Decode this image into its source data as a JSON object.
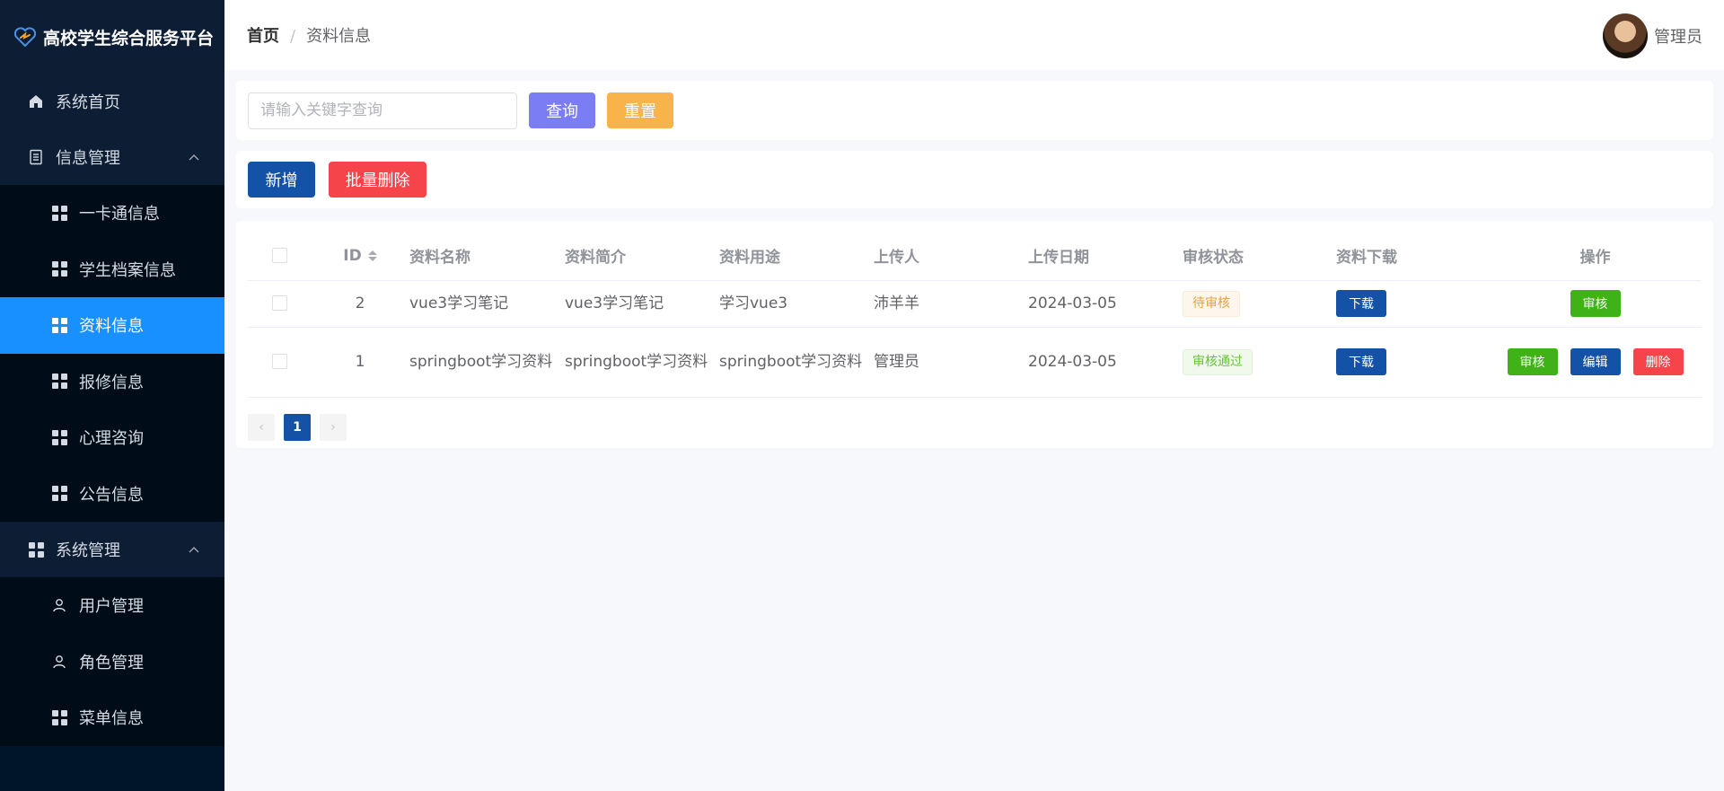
{
  "app": {
    "title": "高校学生综合服务平台"
  },
  "sidebar": {
    "home": "系统首页",
    "info_group": "信息管理",
    "info_items": [
      "一卡通信息",
      "学生档案信息",
      "资料信息",
      "报修信息",
      "心理咨询",
      "公告信息"
    ],
    "sys_group": "系统管理",
    "sys_items": [
      "用户管理",
      "角色管理",
      "菜单信息"
    ]
  },
  "header": {
    "breadcrumb_home": "首页",
    "breadcrumb_sep": "/",
    "breadcrumb_current": "资料信息",
    "user": "管理员"
  },
  "search": {
    "placeholder": "请输入关键字查询",
    "value": "",
    "query_label": "查询",
    "reset_label": "重置"
  },
  "actions": {
    "add_label": "新增",
    "batch_delete_label": "批量删除"
  },
  "table": {
    "columns": [
      "ID",
      "资料名称",
      "资料简介",
      "资料用途",
      "上传人",
      "上传日期",
      "审核状态",
      "资料下载",
      "操作"
    ],
    "rows": [
      {
        "id": "2",
        "name": "vue3学习笔记",
        "intro": "vue3学习笔记",
        "usage": "学习vue3",
        "uploader": "沛羊羊",
        "date": "2024-03-05",
        "status": "待审核",
        "download": "下载",
        "ops": [
          "审核"
        ]
      },
      {
        "id": "1",
        "name": "springboot学习资料",
        "intro": "springboot学习资料",
        "usage": "springboot学习资料",
        "uploader": "管理员",
        "date": "2024-03-05",
        "status": "审核通过",
        "download": "下载",
        "ops": [
          "审核",
          "编辑",
          "删除"
        ]
      }
    ]
  },
  "pagination": {
    "prev": "‹",
    "current": "1",
    "next": "›"
  },
  "colors": {
    "sidebar_bg": "#001529",
    "active": "#1890ff",
    "primary": "#1452a8",
    "danger": "#f5454b",
    "success": "#3fb217",
    "query": "#7b7df5",
    "reset": "#f8b34a"
  }
}
